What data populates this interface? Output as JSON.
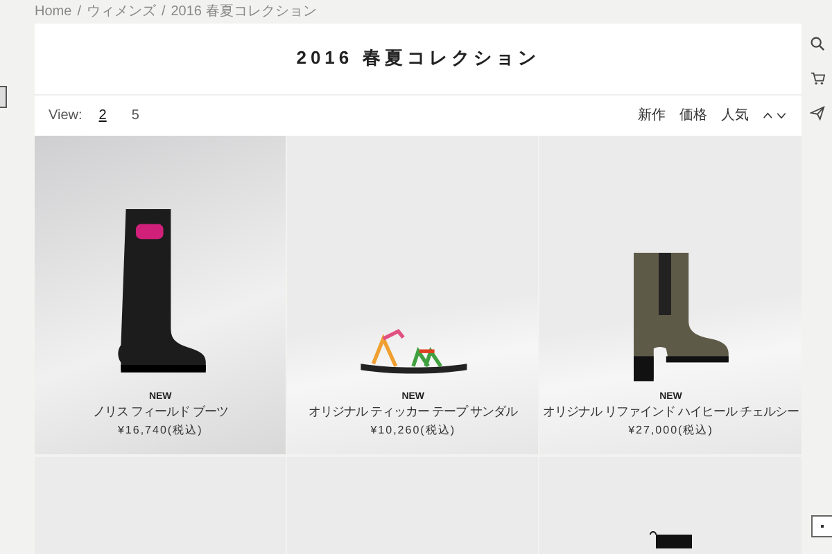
{
  "breadcrumb": [
    {
      "label": "Home"
    },
    {
      "separator": "/",
      "label": "ウィメンズ"
    },
    {
      "separator": "/",
      "label": "2016 春夏コレクション"
    }
  ],
  "title": "2016 春夏コレクション",
  "toolbar": {
    "view_label": "View:",
    "view_options": [
      {
        "label": "2",
        "selected": true
      },
      {
        "label": "5",
        "selected": false
      }
    ],
    "sort_options": [
      "新作",
      "価格",
      "人気"
    ]
  },
  "products": [
    {
      "kind": "tall-boot",
      "badge": "NEW",
      "name": "ノリス フィールド ブーツ",
      "price": "¥16,740(税込)"
    },
    {
      "kind": "sandal",
      "badge": "NEW",
      "name": "オリジナル ティッカー テープ サンダル",
      "price": "¥10,260(税込)"
    },
    {
      "kind": "heel-boot",
      "badge": "NEW",
      "name": "オリジナル リファインド ハイヒール チェルシー",
      "price": "¥27,000(税込)"
    },
    {
      "kind": "blank"
    },
    {
      "kind": "blank"
    },
    {
      "kind": "bag"
    }
  ]
}
